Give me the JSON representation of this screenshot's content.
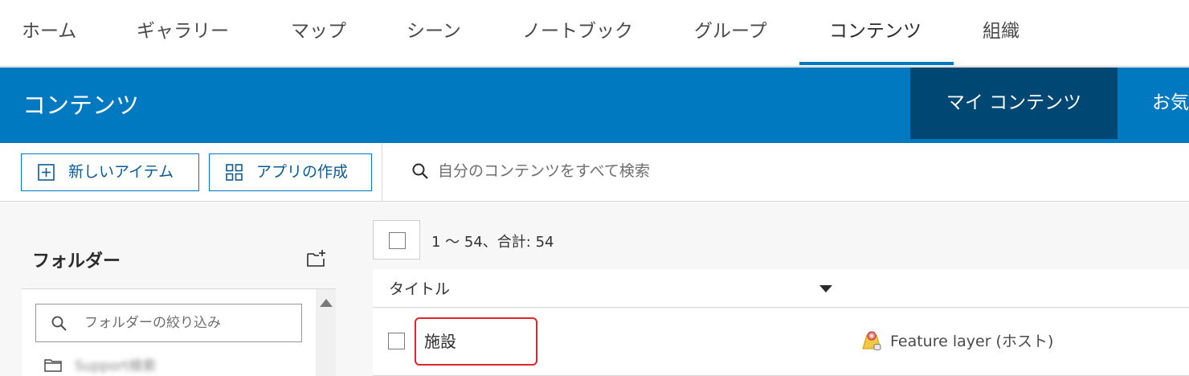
{
  "nav": {
    "items": [
      {
        "label": "ホーム"
      },
      {
        "label": "ギャラリー"
      },
      {
        "label": "マップ"
      },
      {
        "label": "シーン"
      },
      {
        "label": "ノートブック"
      },
      {
        "label": "グループ"
      },
      {
        "label": "コンテンツ",
        "active": true
      },
      {
        "label": "組織"
      }
    ]
  },
  "header": {
    "title": "コンテンツ",
    "tabs": [
      {
        "label": "マイ コンテンツ",
        "active": true
      },
      {
        "label": "お気"
      }
    ]
  },
  "toolbar": {
    "new_item_label": "新しいアイテム",
    "create_app_label": "アプリの作成",
    "search_placeholder": "自分のコンテンツをすべて検索"
  },
  "folders": {
    "title": "フォルダー",
    "filter_placeholder": "フォルダーの絞り込み",
    "items": [
      {
        "name": "Support検索"
      }
    ]
  },
  "results": {
    "count_text": "1 〜 54、合計: 54",
    "column_title": "タイトル",
    "rows": [
      {
        "title": "施設",
        "type": "Feature layer (ホスト)",
        "type_icon": "feature-layer-icon"
      }
    ]
  },
  "colors": {
    "brand_blue": "#0079c1",
    "active_tab": "#004874",
    "highlight_red": "#e0262c"
  }
}
